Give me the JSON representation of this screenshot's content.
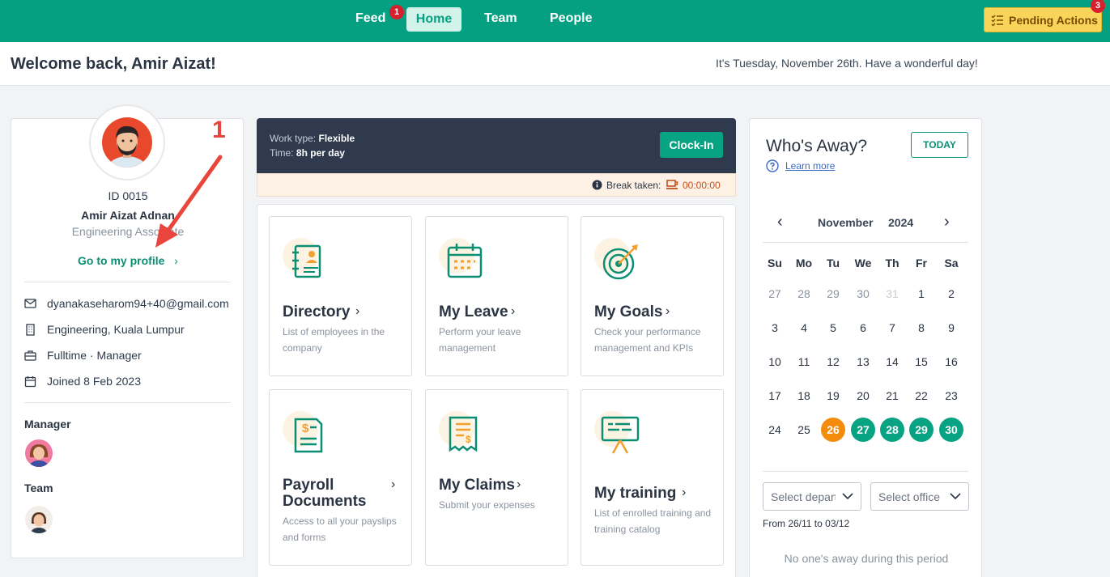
{
  "nav": {
    "feed": "Feed",
    "feed_badge": "1",
    "home": "Home",
    "team": "Team",
    "people": "People",
    "pending_actions": "Pending Actions",
    "pending_badge": "3"
  },
  "welcome": {
    "title": "Welcome back, Amir Aizat!",
    "date_text": "It's Tuesday, November 26th. Have a wonderful day!"
  },
  "profile": {
    "id": "ID 0015",
    "name": "Amir Aizat Adnan",
    "role": "Engineering Associate",
    "link": "Go to my profile",
    "email": "dyanakaseharom94+40@gmail.com",
    "department": "Engineering, Kuala Lumpur",
    "employment": "Fulltime · Manager",
    "joined": "Joined 8 Feb 2023",
    "manager_label": "Manager",
    "team_label": "Team"
  },
  "annotation": {
    "number": "1"
  },
  "clock": {
    "work_type_label": "Work type:",
    "work_type": "Flexible",
    "time_label": "Time:",
    "time": "8h per day",
    "clockin": "Clock-In",
    "break_label": "Break taken:",
    "break_time": "00:00:00"
  },
  "tiles": [
    {
      "title": "Directory",
      "desc": "List of employees in the company",
      "icon": "directory-icon"
    },
    {
      "title": "My Leave",
      "desc": "Perform your leave management",
      "icon": "calendar-icon"
    },
    {
      "title": "My Goals",
      "desc": "Check your performance management and KPIs",
      "icon": "target-icon"
    },
    {
      "title": "Payroll Documents",
      "desc": "Access to all your payslips and forms",
      "icon": "payslip-icon"
    },
    {
      "title": "My Claims",
      "desc": "Submit your expenses",
      "icon": "receipt-icon"
    },
    {
      "title": "My training",
      "desc": "List of enrolled training and training catalog",
      "icon": "presentation-icon"
    }
  ],
  "away": {
    "title": "Who's Away?",
    "today": "TODAY",
    "learn_more": "Learn more",
    "month": "November",
    "year": "2024",
    "weekdays": [
      "Su",
      "Mo",
      "Tu",
      "We",
      "Th",
      "Fr",
      "Sa"
    ],
    "weeks": [
      [
        "27",
        "28",
        "29",
        "30",
        "31",
        "1",
        "2"
      ],
      [
        "3",
        "4",
        "5",
        "6",
        "7",
        "8",
        "9"
      ],
      [
        "10",
        "11",
        "12",
        "13",
        "14",
        "15",
        "16"
      ],
      [
        "17",
        "18",
        "19",
        "20",
        "21",
        "22",
        "23"
      ],
      [
        "24",
        "25",
        "26",
        "27",
        "28",
        "29",
        "30"
      ]
    ],
    "select_department": "Select department",
    "select_office": "Select office",
    "range": "From 26/11 to 03/12",
    "empty": "No one's away during this period",
    "colors": {
      "today": "#f38b0c",
      "selected": "#08a382"
    }
  }
}
